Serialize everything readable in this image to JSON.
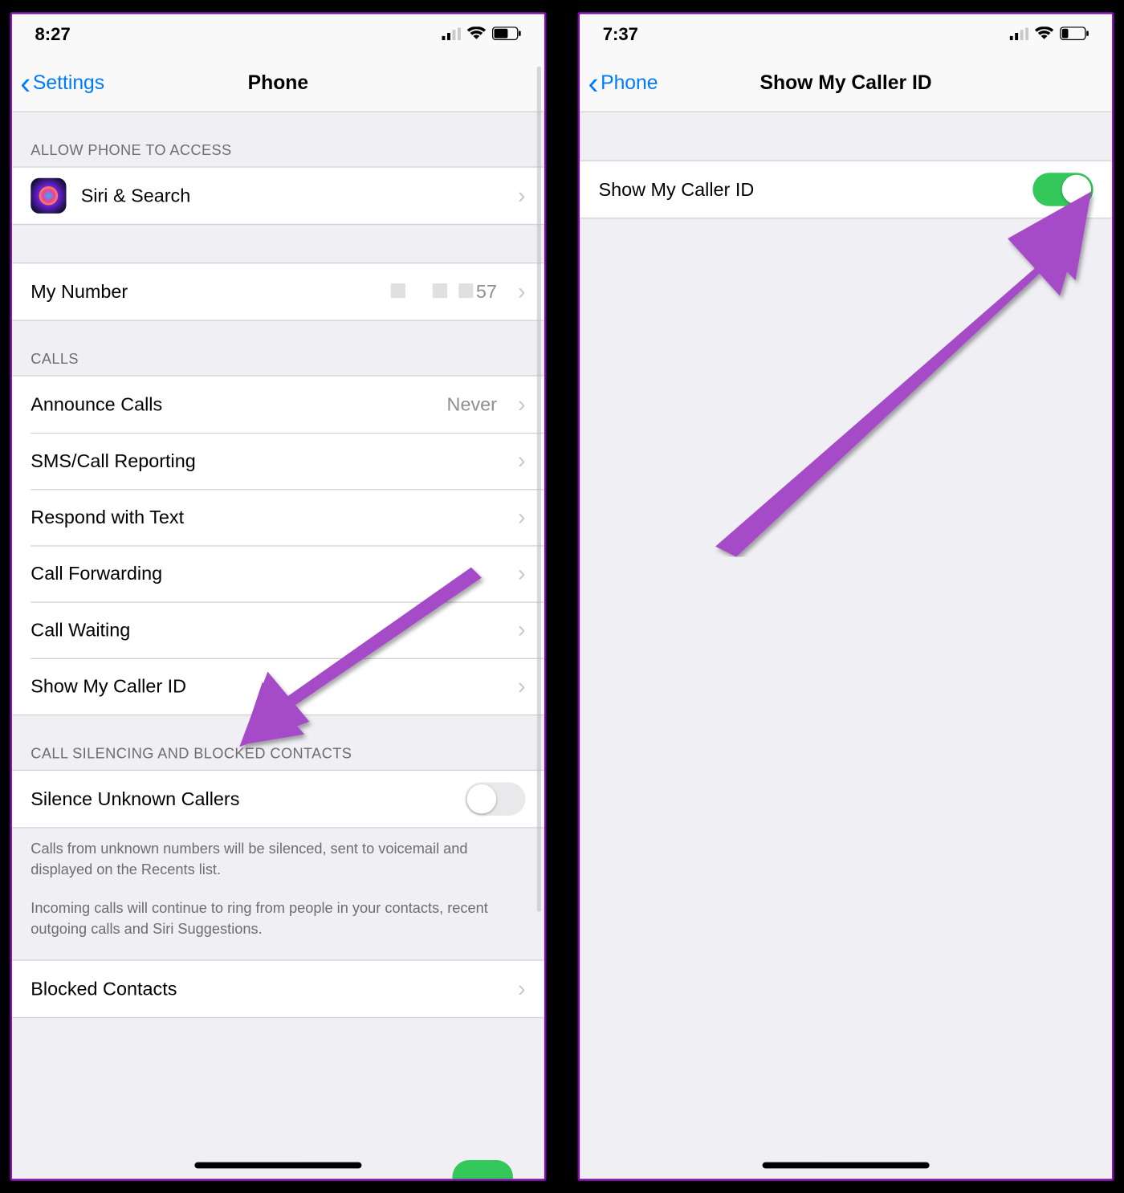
{
  "left": {
    "time": "8:27",
    "back_label": "Settings",
    "title": "Phone",
    "section1_header": "ALLOW PHONE TO ACCESS",
    "siri_label": "Siri & Search",
    "my_number_label": "My Number",
    "my_number_trailing": "57",
    "section_calls": "CALLS",
    "rows_calls": [
      {
        "label": "Announce Calls",
        "value": "Never"
      },
      {
        "label": "SMS/Call Reporting",
        "value": ""
      },
      {
        "label": "Respond with Text",
        "value": ""
      },
      {
        "label": "Call Forwarding",
        "value": ""
      },
      {
        "label": "Call Waiting",
        "value": ""
      },
      {
        "label": "Show My Caller ID",
        "value": ""
      }
    ],
    "section_silencing": "CALL SILENCING AND BLOCKED CONTACTS",
    "silence_label": "Silence Unknown Callers",
    "silence_on": false,
    "footer1": "Calls from unknown numbers will be silenced, sent to voicemail and displayed on the Recents list.",
    "footer2": "Incoming calls will continue to ring from people in your contacts, recent outgoing calls and Siri Suggestions.",
    "blocked_label": "Blocked Contacts"
  },
  "right": {
    "time": "7:37",
    "back_label": "Phone",
    "title": "Show My Caller ID",
    "row_label": "Show My Caller ID",
    "toggle_on": true
  }
}
